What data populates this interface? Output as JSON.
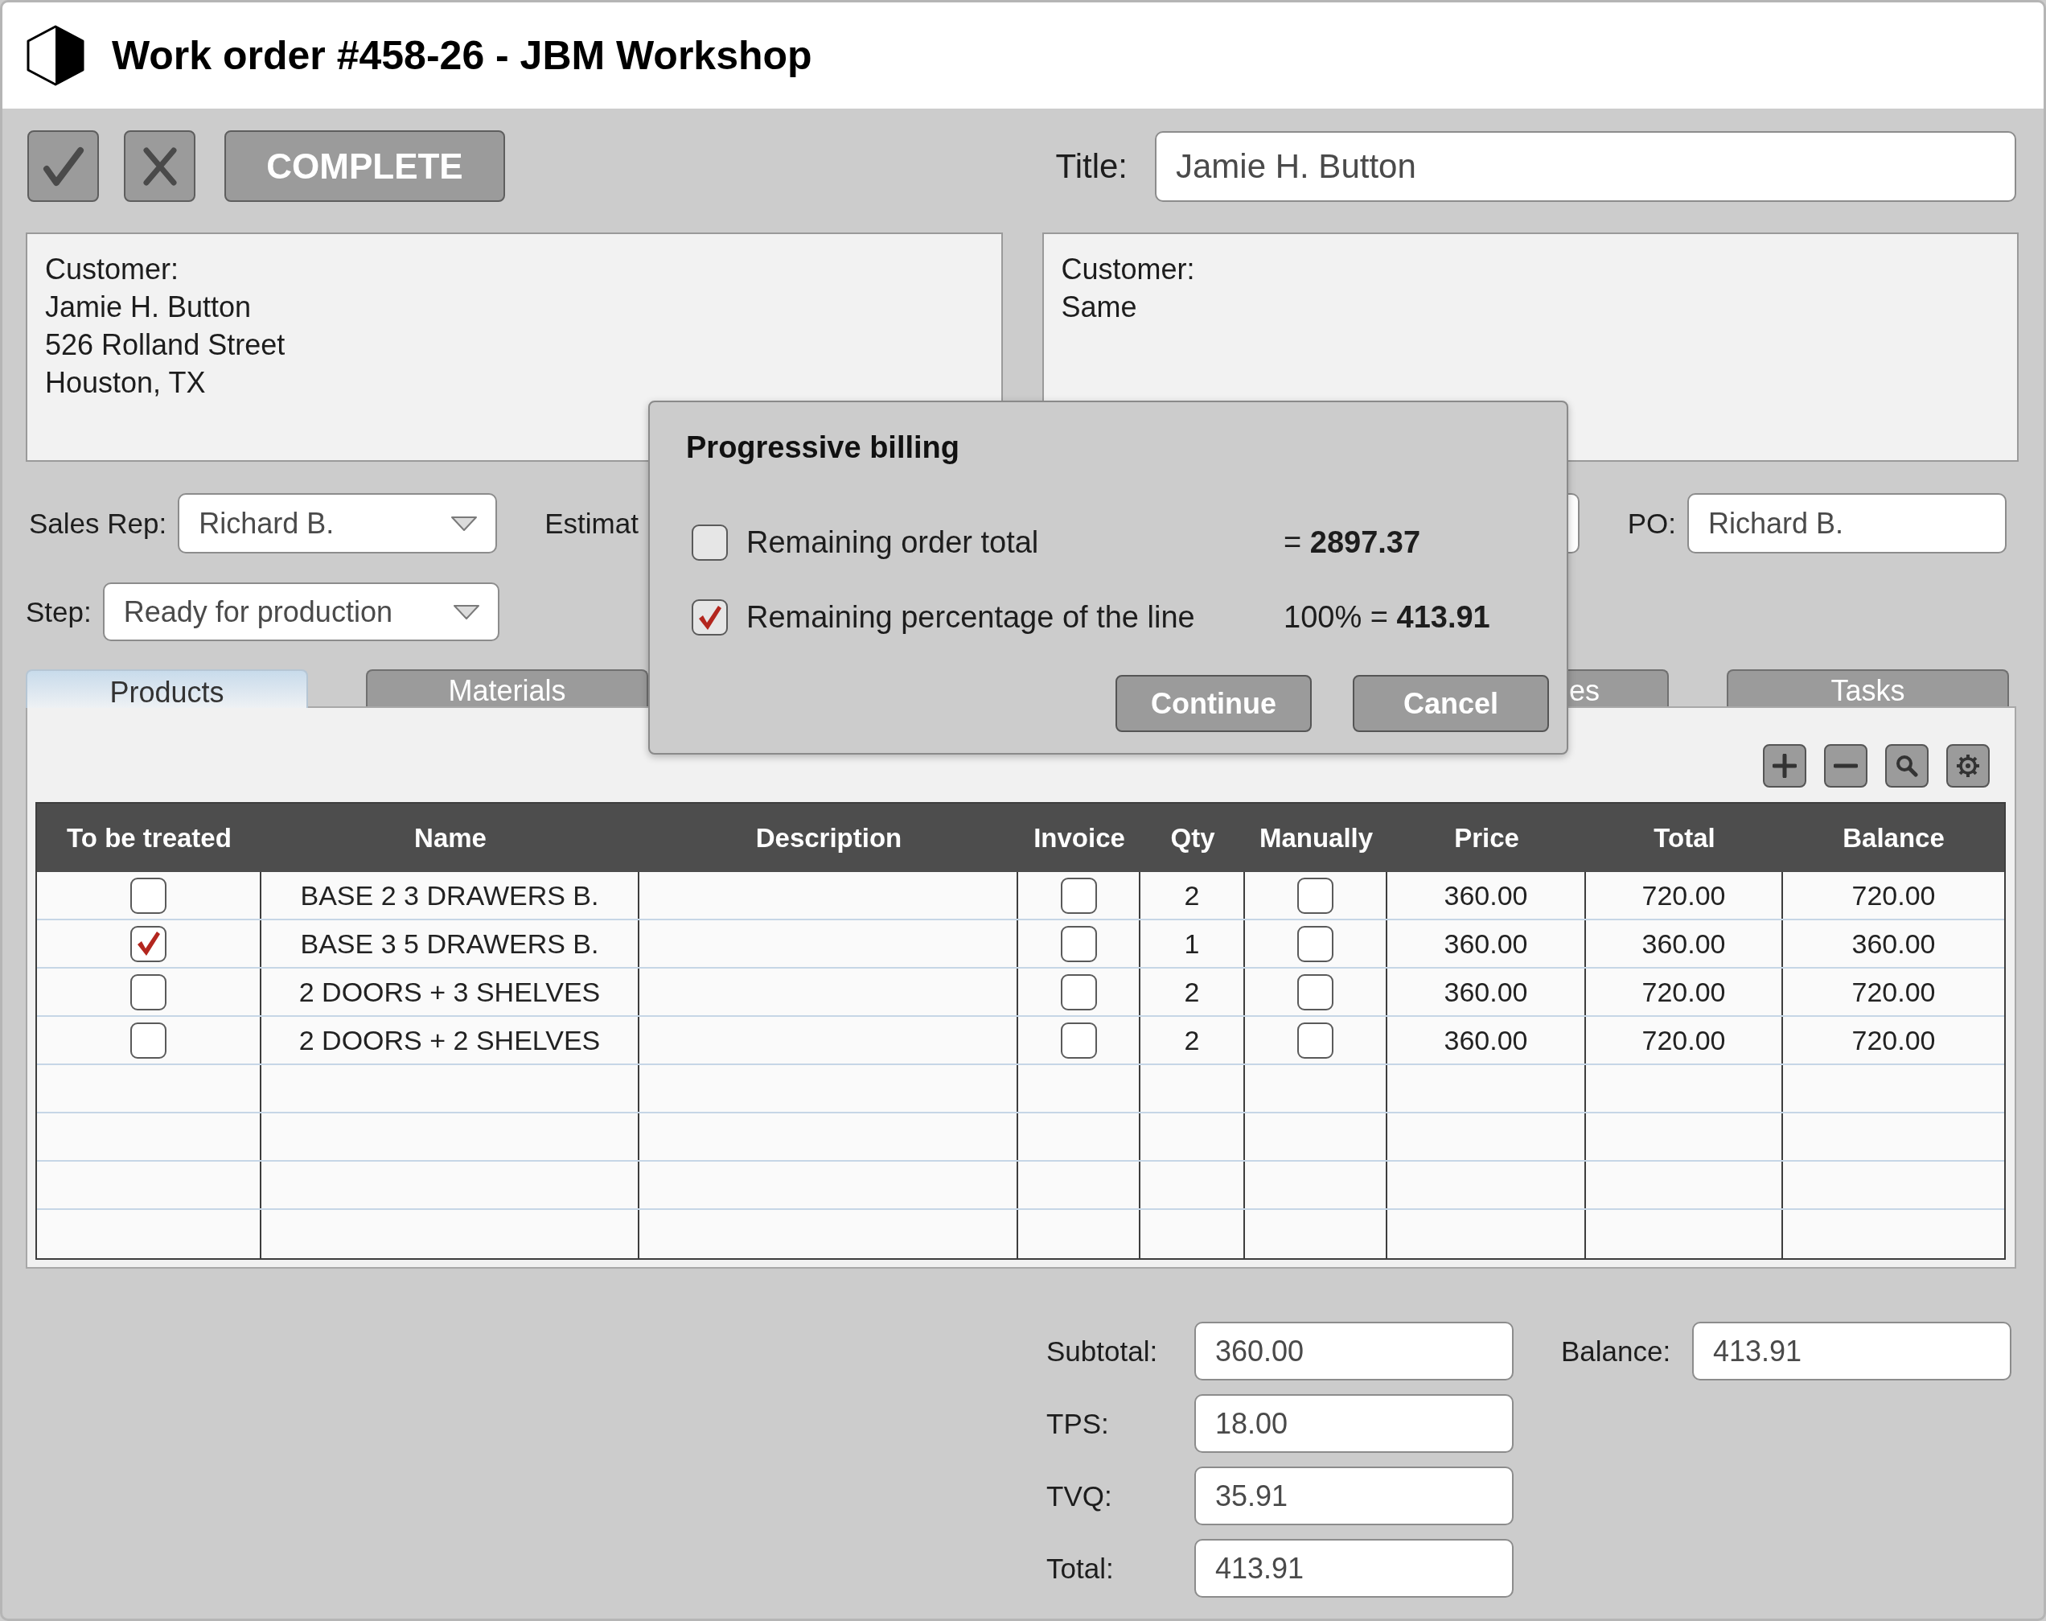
{
  "window": {
    "title": "Work order #458-26 - JBM Workshop"
  },
  "toolbar": {
    "complete": "COMPLETE",
    "title_label": "Title:",
    "title_value": "Jamie H. Button"
  },
  "customer_panels": [
    {
      "heading": "Customer:",
      "lines": [
        "Jamie H. Button",
        "526 Rolland Street",
        "Houston, TX"
      ]
    },
    {
      "heading": "Customer:",
      "lines": [
        "Same"
      ]
    }
  ],
  "sales_rep": {
    "label": "Sales Rep:",
    "value": "Richard B."
  },
  "estimate": {
    "label": "Estimat"
  },
  "po": {
    "label": "PO:",
    "value": "Richard B."
  },
  "step": {
    "label": "Step:",
    "value": "Ready for production"
  },
  "tabs": [
    {
      "label": "Products",
      "selected": true
    },
    {
      "label": "Materials",
      "selected": false
    },
    {
      "label": "es",
      "selected": false
    },
    {
      "label": "Tasks",
      "selected": false
    }
  ],
  "table": {
    "columns": [
      "To be treated",
      "Name",
      "Description",
      "Invoice",
      "Qty",
      "Manually",
      "Price",
      "Total",
      "Balance"
    ],
    "rows": [
      {
        "to_be_treated": false,
        "name": "BASE 2 3 DRAWERS B.",
        "invoice": false,
        "qty": "2",
        "manually": false,
        "price": "360.00",
        "total": "720.00",
        "balance": "720.00"
      },
      {
        "to_be_treated": true,
        "name": "BASE 3 5 DRAWERS B.",
        "invoice": false,
        "qty": "1",
        "manually": false,
        "price": "360.00",
        "total": "360.00",
        "balance": "360.00"
      },
      {
        "to_be_treated": false,
        "name": "2 DOORS + 3 SHELVES",
        "invoice": false,
        "qty": "2",
        "manually": false,
        "price": "360.00",
        "total": "720.00",
        "balance": "720.00"
      },
      {
        "to_be_treated": false,
        "name": "2 DOORS + 2 SHELVES",
        "invoice": false,
        "qty": "2",
        "manually": false,
        "price": "360.00",
        "total": "720.00",
        "balance": "720.00"
      }
    ]
  },
  "totals": [
    {
      "label": "Subtotal:",
      "value": "360.00"
    },
    {
      "label": "TPS:",
      "value": "18.00"
    },
    {
      "label": "TVQ:",
      "value": "35.91"
    },
    {
      "label": "Total:",
      "value": "413.91"
    }
  ],
  "balance": {
    "label": "Balance:",
    "value": "413.91"
  },
  "dialog": {
    "title": "Progressive billing",
    "options": [
      {
        "label": "Remaining order total",
        "checked": false,
        "amount": "= **2897.37**"
      },
      {
        "label": "Remaining percentage of the line",
        "checked": true,
        "amount": "100% = **413.91**"
      }
    ],
    "buttons": [
      "Continue",
      "Cancel"
    ]
  }
}
